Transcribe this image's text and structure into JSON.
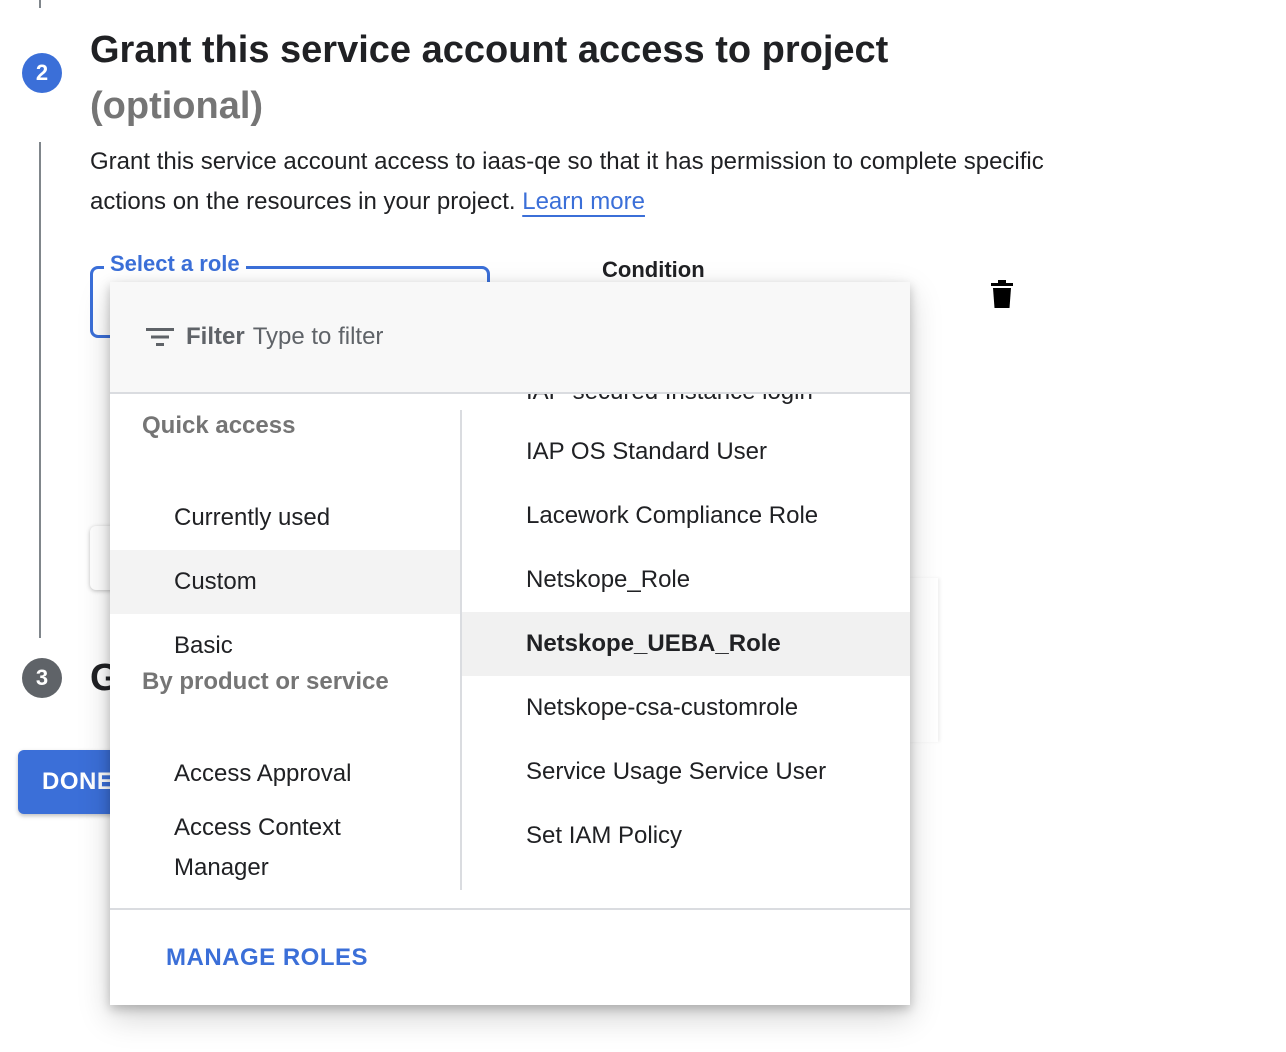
{
  "step2": {
    "number": "2",
    "title": "Grant this service account access to project",
    "optional": "(optional)",
    "description": "Grant this service account access to iaas-qe so that it has permission to complete specific actions on the resources in your project.",
    "learn_more": "Learn more"
  },
  "role_select": {
    "label": "Select a role"
  },
  "condition": {
    "label": "Condition"
  },
  "step3": {
    "number": "3",
    "title_visible": "G"
  },
  "done_button": {
    "label": "DONE"
  },
  "menu": {
    "filter": {
      "label": "Filter",
      "placeholder": "Type to filter"
    },
    "categories": {
      "quick_access_header": "Quick access",
      "quick_access": [
        "Currently used",
        "Custom",
        "Basic"
      ],
      "by_product_header": "By product or service",
      "by_product": [
        "Access Approval",
        "Access Context Manager"
      ]
    },
    "selected_category": "Custom",
    "roles": [
      "IAP-secured Instance login",
      "IAP OS Standard User",
      "Lacework Compliance Role",
      "Netskope_Role",
      "Netskope_UEBA_Role",
      "Netskope-csa-customrole",
      "Service Usage Service User",
      "Set IAM Policy"
    ],
    "highlighted_role": "Netskope_UEBA_Role",
    "manage_roles": "MANAGE ROLES"
  },
  "colors": {
    "accent": "#3b6fd8",
    "step_inactive": "#5f6368"
  },
  "icons": {
    "filter": "filter-list-icon",
    "delete": "trash-icon"
  }
}
